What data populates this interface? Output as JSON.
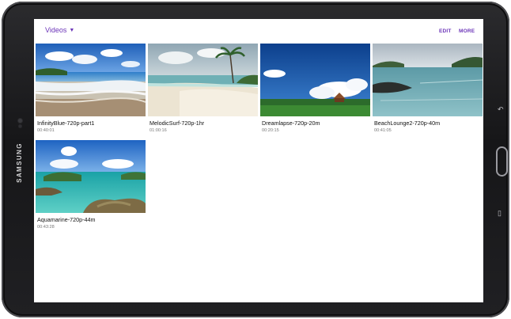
{
  "device": {
    "brand": "SAMSUNG"
  },
  "header": {
    "folder_label": "Videos",
    "edit_label": "EDIT",
    "more_label": "MORE",
    "accent_color": "#6b34b8"
  },
  "videos": [
    {
      "title": "InfinityBlue-720p-part1",
      "duration": "00:40:01"
    },
    {
      "title": "MelodicSurf-720p-1hr",
      "duration": "01:00:16"
    },
    {
      "title": "Dreamlapse-720p-20m",
      "duration": "00:20:15"
    },
    {
      "title": "BeachLounge2-720p-40m",
      "duration": "00:41:05"
    },
    {
      "title": "Aquamarine-720p-44m",
      "duration": "00:43:28"
    }
  ]
}
